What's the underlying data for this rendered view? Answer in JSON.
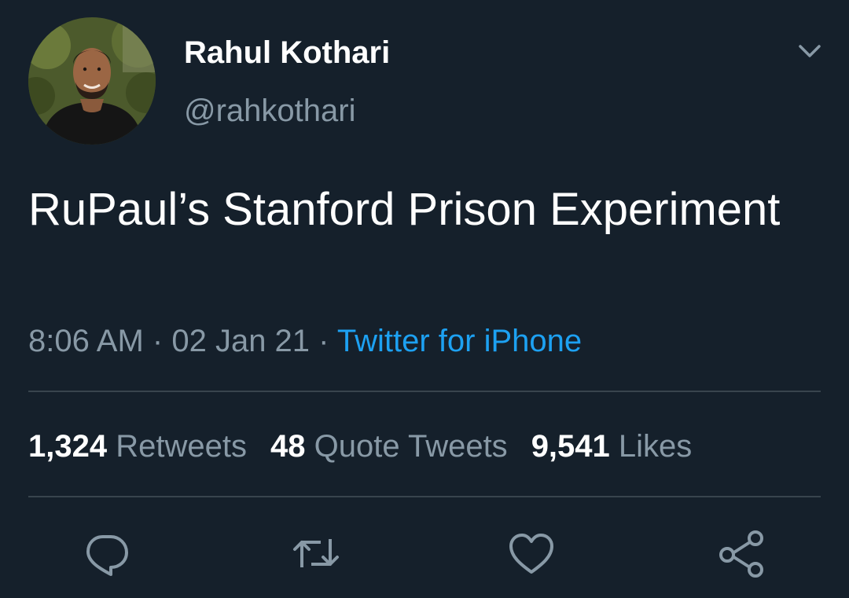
{
  "tweet": {
    "author": {
      "display_name": "Rahul Kothari",
      "handle": "@rahkothari"
    },
    "text": "RuPaul’s Stanford Prison Experiment",
    "time": "8:06 AM",
    "date": "02 Jan 21",
    "separator": "·",
    "source": "Twitter for iPhone"
  },
  "stats": {
    "retweets": {
      "count": "1,324",
      "label": "Retweets"
    },
    "quote_tweets": {
      "count": "48",
      "label": "Quote Tweets"
    },
    "likes": {
      "count": "9,541",
      "label": "Likes"
    }
  },
  "actions": {
    "reply_icon": "reply-icon",
    "retweet_icon": "retweet-icon",
    "like_icon": "heart-icon",
    "share_icon": "share-icon"
  },
  "colors": {
    "background": "#15202b",
    "primary_text": "#ffffff",
    "secondary_text": "#8899a6",
    "link": "#1da1f2",
    "divider": "#38444d"
  }
}
